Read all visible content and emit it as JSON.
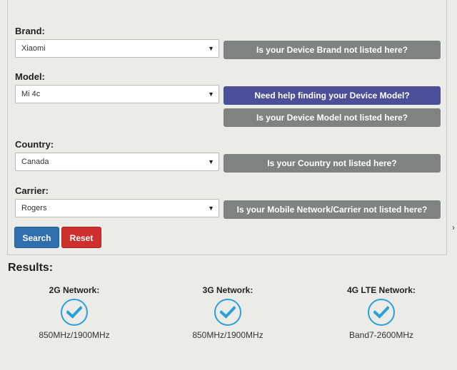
{
  "form": {
    "brand": {
      "label": "Brand:",
      "value": "Xiaomi",
      "help_button": "Is your Device Brand not listed here?"
    },
    "model": {
      "label": "Model:",
      "value": "Mi 4c",
      "help_find_button": "Need help finding your Device Model?",
      "help_button": "Is your Device Model not listed here?"
    },
    "country": {
      "label": "Country:",
      "value": "Canada",
      "help_button": "Is your Country not listed here?"
    },
    "carrier": {
      "label": "Carrier:",
      "value": "Rogers",
      "help_button": "Is your Mobile Network/Carrier not listed here?"
    },
    "search_label": "Search",
    "reset_label": "Reset"
  },
  "results": {
    "title": "Results:",
    "items": [
      {
        "network": "2G Network:",
        "frequency": "850MHz/1900MHz",
        "status": "check-icon"
      },
      {
        "network": "3G Network:",
        "frequency": "850MHz/1900MHz",
        "status": "check-icon"
      },
      {
        "network": "4G LTE Network:",
        "frequency": "Band7-2600MHz",
        "status": "check-icon"
      }
    ]
  },
  "colors": {
    "gray_button": "#7f8280",
    "blue_button": "#4b4f97",
    "search_button": "#2f6fad",
    "reset_button": "#cf2f2f",
    "check": "#2b9fd9"
  }
}
